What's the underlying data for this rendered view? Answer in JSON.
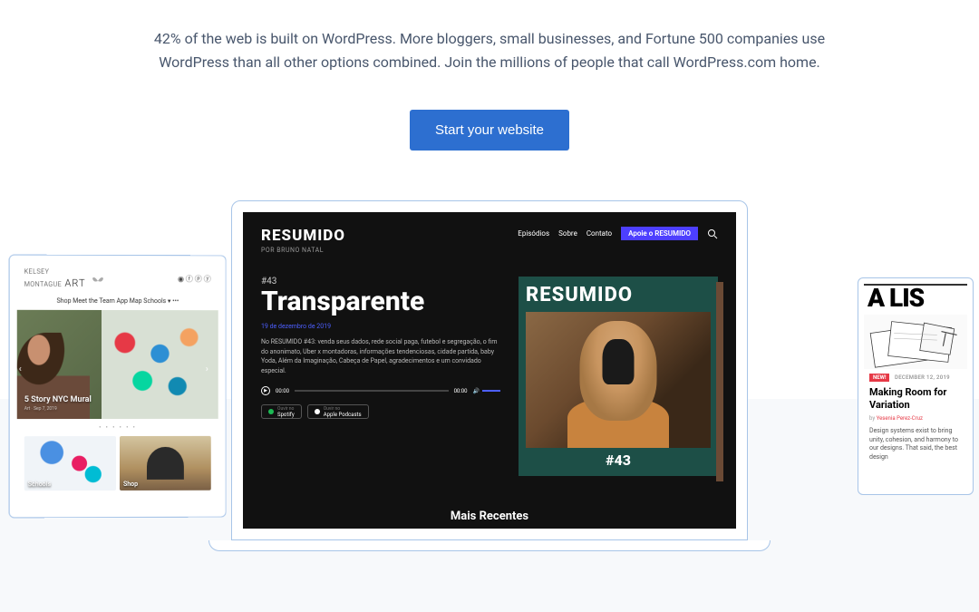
{
  "hero": {
    "text": "42% of the web is built on WordPress. More bloggers, small businesses, and Fortune 500 companies use WordPress than all other options combined. Join the millions of people that call WordPress.com home.",
    "cta": "Start your website"
  },
  "left_device": {
    "logo_top": "KELSEY",
    "logo_bottom": "MONTAGUE",
    "logo_art": "ART",
    "social": "◉ ⓕ ⓟ ⓨ",
    "nav": "Shop   Meet the Team   App   Map   Schools ▾   •••",
    "hero_caption": "5 Story NYC Mural",
    "hero_sub": "Art · Sep 7, 2019",
    "dots": "• • • • • •",
    "thumb1_label": "Schools",
    "thumb2_label": "Shop"
  },
  "center_device": {
    "brand": "RESUMIDO",
    "brand_sub": "POR BRUNO NATAL",
    "nav": [
      "Episódios",
      "Sobre",
      "Contato"
    ],
    "nav_cta": "Apoie o RESUMIDO",
    "ep_num": "#43",
    "title": "Transparente",
    "date": "19 de dezembro de 2019",
    "desc": "No RESUMIDO #43: venda seus dados, rede social paga, futebol e segregação, o fim do anonimato, Uber x montadoras, informações tendenciosas, cidade partida, baby Yoda, Além da Imaginação, Cabeça de Papel, agradecimentos e um convidado especial.",
    "time_start": "00:00",
    "time_end": "00:00",
    "badge_sp": "Spotify",
    "badge_ap": "Apple Podcasts",
    "badge_prefix": "Ouvir no",
    "art_title": "RESUMIDO",
    "art_ep": "#43",
    "footer": "Mais Recentes"
  },
  "right_device": {
    "logo": "A LIS",
    "new_label": "NEW!",
    "date": "DECEMBER 12, 2019",
    "title": "Making Room for Variation",
    "author_by": "by",
    "author": "Yesenia Perez-Cruz",
    "body": "Design systems exist to bring unity, cohesion, and harmony to our designs. That said, the best design"
  }
}
